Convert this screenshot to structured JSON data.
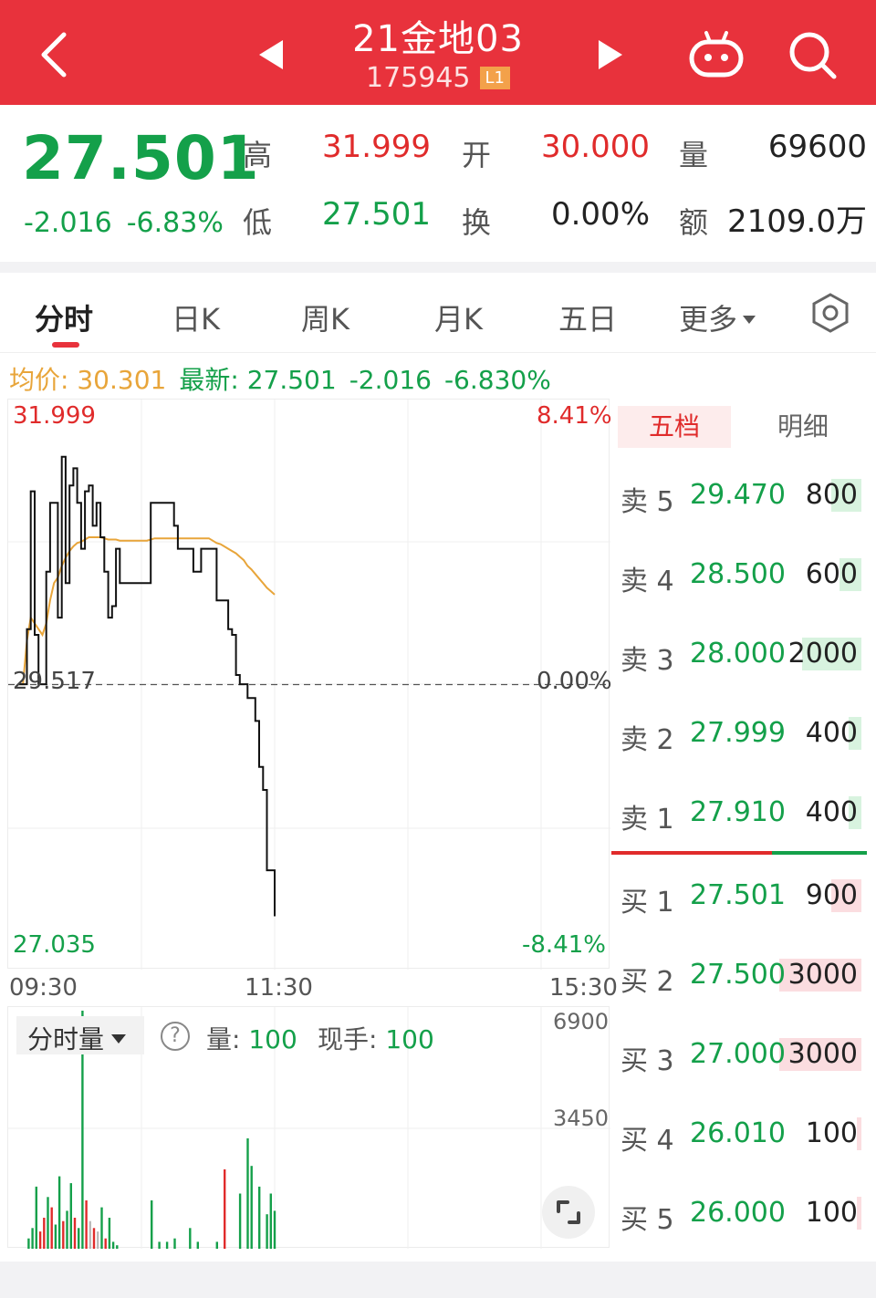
{
  "header": {
    "title": "21金地03",
    "code": "175945",
    "level_badge": "L1",
    "bg_color": "#e8323c"
  },
  "quote": {
    "last_price": "27.501",
    "change": "-2.016",
    "change_pct": "-6.83%",
    "high_label": "高",
    "high": "31.999",
    "open_label": "开",
    "open": "30.000",
    "volume_label": "量",
    "volume": "69600",
    "low_label": "低",
    "low": "27.501",
    "turnover_label": "换",
    "turnover": "0.00%",
    "amount_label": "额",
    "amount": "2109.0万"
  },
  "tabs": {
    "items": [
      "分时",
      "日K",
      "周K",
      "月K",
      "五日",
      "更多"
    ],
    "active": "分时"
  },
  "info": {
    "avg_label": "均价",
    "avg_value": "30.301",
    "latest_label": "最新",
    "latest_value": "27.501",
    "latest_change": "-2.016",
    "latest_pct": "-6.830%"
  },
  "chart_data": {
    "type": "line",
    "y_top": "31.999",
    "y_mid": "29.517",
    "y_bottom": "27.035",
    "pct_top": "8.41%",
    "pct_mid": "0.00%",
    "pct_bottom": "-8.41%",
    "time_labels": [
      "09:30",
      "11:30",
      "15:30"
    ],
    "ylim": [
      27.035,
      31.999
    ],
    "prev_close": 29.517,
    "price_series": [
      29.52,
      29.52,
      30.0,
      31.2,
      29.95,
      29.52,
      29.52,
      30.5,
      31.1,
      31.1,
      30.1,
      31.5,
      30.4,
      31.25,
      31.4,
      31.1,
      30.7,
      31.2,
      31.25,
      30.9,
      31.1,
      30.8,
      30.5,
      30.1,
      30.2,
      30.7,
      30.4,
      30.4,
      30.4,
      30.4,
      30.4,
      30.4,
      30.4,
      30.4,
      31.1,
      31.1,
      31.1,
      31.1,
      31.1,
      31.1,
      30.9,
      30.7,
      30.7,
      30.7,
      30.7,
      30.5,
      30.5,
      30.7,
      30.7,
      30.7,
      30.7,
      30.25,
      30.25,
      30.25,
      30.0,
      29.95,
      29.6,
      29.52,
      29.52,
      29.4,
      29.4,
      29.2,
      28.8,
      28.6,
      27.9,
      27.9,
      27.5
    ],
    "avg_series": [
      29.52,
      29.52,
      29.9,
      30.1,
      30.05,
      30.0,
      29.95,
      30.05,
      30.25,
      30.4,
      30.45,
      30.55,
      30.62,
      30.68,
      30.72,
      30.75,
      30.76,
      30.78,
      30.8,
      30.8,
      30.8,
      30.8,
      30.79,
      30.78,
      30.78,
      30.78,
      30.77,
      30.77,
      30.77,
      30.77,
      30.77,
      30.77,
      30.77,
      30.77,
      30.78,
      30.79,
      30.79,
      30.79,
      30.79,
      30.79,
      30.79,
      30.79,
      30.79,
      30.79,
      30.79,
      30.79,
      30.79,
      30.79,
      30.79,
      30.79,
      30.77,
      30.75,
      30.74,
      30.72,
      30.7,
      30.68,
      30.66,
      30.63,
      30.6,
      30.55,
      30.52,
      30.48,
      30.44,
      30.4,
      30.36,
      30.33,
      30.3
    ],
    "volume": [
      0,
      0,
      300,
      600,
      1800,
      500,
      900,
      1500,
      1200,
      700,
      2100,
      800,
      1100,
      1900,
      900,
      600,
      6900,
      1400,
      800,
      600,
      500,
      1200,
      300,
      900,
      200,
      100,
      0,
      0,
      0,
      0,
      0,
      0,
      0,
      0,
      1400,
      0,
      200,
      0,
      200,
      0,
      300,
      0,
      0,
      0,
      600,
      0,
      200,
      0,
      0,
      0,
      0,
      200,
      0,
      2300,
      0,
      0,
      0,
      1600,
      0,
      3200,
      2400,
      0,
      1800,
      0,
      1000,
      1600,
      1100
    ],
    "volume_colors": [
      "r",
      "r",
      "g",
      "g",
      "g",
      "r",
      "r",
      "g",
      "r",
      "g",
      "g",
      "r",
      "g",
      "g",
      "r",
      "g",
      "g",
      "r",
      "gr",
      "r",
      "gr",
      "g",
      "r",
      "g",
      "g",
      "g",
      "g",
      "g",
      "g",
      "g",
      "g",
      "g",
      "g",
      "g",
      "g",
      "g",
      "g",
      "g",
      "g",
      "g",
      "g",
      "g",
      "g",
      "g",
      "g",
      "g",
      "g",
      "g",
      "g",
      "g",
      "g",
      "g",
      "g",
      "r",
      "g",
      "g",
      "g",
      "g",
      "g",
      "g",
      "g",
      "g",
      "g",
      "g",
      "g",
      "g",
      "g"
    ]
  },
  "volume_panel": {
    "dropdown_label": "分时量",
    "vol_label": "量",
    "vol_value": "100",
    "hand_label": "现手",
    "hand_value": "100",
    "axis_top": "6900",
    "axis_mid": "3450"
  },
  "order_book": {
    "tab_active": "五档",
    "tab_other": "明细",
    "sell": [
      {
        "label": "卖5",
        "price": "29.470",
        "volume": "800",
        "share": 0.12
      },
      {
        "label": "卖4",
        "price": "28.500",
        "volume": "600",
        "share": 0.09
      },
      {
        "label": "卖3",
        "price": "28.000",
        "volume": "2000",
        "share": 0.24
      },
      {
        "label": "卖2",
        "price": "27.999",
        "volume": "400",
        "share": 0.05
      },
      {
        "label": "卖1",
        "price": "27.910",
        "volume": "400",
        "share": 0.05
      }
    ],
    "buy": [
      {
        "label": "买1",
        "price": "27.501",
        "volume": "900",
        "share": 0.12
      },
      {
        "label": "买2",
        "price": "27.500",
        "volume": "3000",
        "share": 0.33
      },
      {
        "label": "买3",
        "price": "27.000",
        "volume": "3000",
        "share": 0.33
      },
      {
        "label": "买4",
        "price": "26.010",
        "volume": "100",
        "share": 0.02
      },
      {
        "label": "买5",
        "price": "26.000",
        "volume": "100",
        "share": 0.02
      }
    ]
  }
}
